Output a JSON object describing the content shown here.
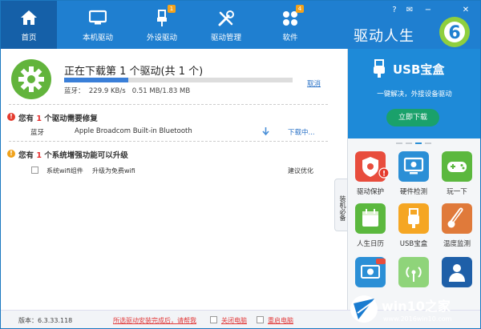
{
  "topbar": {
    "nav": [
      {
        "label": "首页",
        "icon": "home-icon"
      },
      {
        "label": "本机驱动",
        "icon": "monitor-icon"
      },
      {
        "label": "外设驱动",
        "icon": "usb-plug-icon",
        "badge": "1"
      },
      {
        "label": "驱动管理",
        "icon": "tools-icon"
      },
      {
        "label": "软件",
        "icon": "apps-icon",
        "badge": "4"
      }
    ],
    "brand": "驱动人生",
    "window_controls": [
      "help-icon",
      "skin-icon",
      "minimize-icon",
      "close-icon"
    ]
  },
  "download": {
    "title": "正在下载第 1 个驱动(共 1 个)",
    "progress": 0.28,
    "speed_line": "蓝牙：  229.9 KB/s   0.51 MB/1.83 MB",
    "cancel": "取消"
  },
  "repair": {
    "prefix": "您有 ",
    "count": "1",
    "suffix": " 个驱动需要修复",
    "row": {
      "category": "蓝牙",
      "device": "Apple Broadcom Built-in Bluetooth",
      "status": "下载中..."
    }
  },
  "upgrade": {
    "prefix": "您有 ",
    "count": "1",
    "suffix": " 个系统增强功能可以升级",
    "row": {
      "name": "系统wifi组件",
      "desc": "升级为免费wifi",
      "action": "建议优化"
    }
  },
  "side_tab": "装机必备",
  "banner": {
    "title": "USB宝盒",
    "subtitle": "一键解决，外接设备驱动",
    "button": "立即下载"
  },
  "tiles": [
    {
      "label": "驱动保护",
      "icon": "shield-gear-icon",
      "color": "#e84d3d"
    },
    {
      "label": "硬件检测",
      "icon": "monitor-check-icon",
      "color": "#2b8fd6"
    },
    {
      "label": "玩一下",
      "icon": "gamepad-icon",
      "color": "#5bb83e"
    },
    {
      "label": "人生日历",
      "icon": "calendar-icon",
      "color": "#5bb83e"
    },
    {
      "label": "USB宝盒",
      "icon": "usb-box-icon",
      "color": "#f5a623"
    },
    {
      "label": "温度监测",
      "icon": "thermometer-icon",
      "color": "#e07a3a"
    },
    {
      "label": "",
      "icon": "disc-new-icon",
      "color": "#2b8fd6"
    },
    {
      "label": "",
      "icon": "signal-icon",
      "color": "#8fd47a"
    },
    {
      "label": "",
      "icon": "person-icon",
      "color": "#1e5fa8"
    }
  ],
  "bottom": {
    "version": "版本：6.3.33.118",
    "notice": "所选驱动安装完成后，请帮我",
    "shutdown": "关闭电脑",
    "restart": "重启电脑"
  },
  "watermark": {
    "brand": "win10之家",
    "url": "www.2016win10.com"
  }
}
